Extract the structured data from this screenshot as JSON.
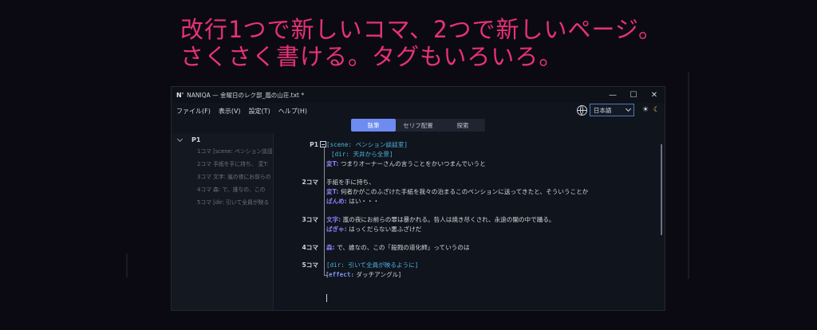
{
  "headline": {
    "line1": "改行1つで新しいコマ、2つで新しいページ。",
    "line2": "さくさく書ける。タグもいろいろ。"
  },
  "window": {
    "logo": "N'",
    "title": "NANIQA — 金曜日のレク部_嵐の山荘.txt *",
    "controls": [
      "—",
      "☐",
      "✕"
    ]
  },
  "menu": [
    "ファイル(F)",
    "表示(V)",
    "設定(T)",
    "ヘルプ(H)"
  ],
  "language": "日本語",
  "tabs": [
    "執筆",
    "セリフ配置",
    "探索"
  ],
  "sidebar": {
    "page": "P1",
    "items": [
      "1コマ [scene: ペンション談話",
      "2コマ 手紙を手に持ち、 変T:",
      "3コマ 文字: 嵐の夜にお前らの",
      "4コマ 森: で、誰なの、この",
      "5コマ [dir: 引いて全員が映る"
    ]
  },
  "editor": {
    "gutter": [
      "P1",
      "2コマ",
      "3コマ",
      "4コマ",
      "5コマ"
    ],
    "lines": [
      {
        "tag": "scene",
        "value": "ペンション談話室"
      },
      {
        "tag": "dir",
        "value": "天井から全景"
      },
      {
        "speaker": "変T:",
        "text": "つまりオーナーさんの言うことをかいつまんでいうと"
      },
      {
        "text": "手紙を手に持ち、"
      },
      {
        "speaker": "変T:",
        "text": "何者かがこのふざけた手紙を我々の泊まるこのペンションに送ってきたと、そういうことか"
      },
      {
        "speaker": "ぱんめ:",
        "text": "はい・・・"
      },
      {
        "speaker": "文字:",
        "text": "嵐の夜にお前らの罪は暴かれる。咎人は焼き尽くされ、永遠の闇の中で踊る。"
      },
      {
        "speaker": "ばぎゃ:",
        "text": "はっくだらない悪ふざけだ"
      },
      {
        "speaker": "森:",
        "text": "で、誰なの、この「殺戮の道化師」っていうのは"
      },
      {
        "tag": "dir",
        "value": "引いて全員が映るように"
      },
      {
        "tag": "effect",
        "value": "ダッチアングル"
      }
    ]
  }
}
